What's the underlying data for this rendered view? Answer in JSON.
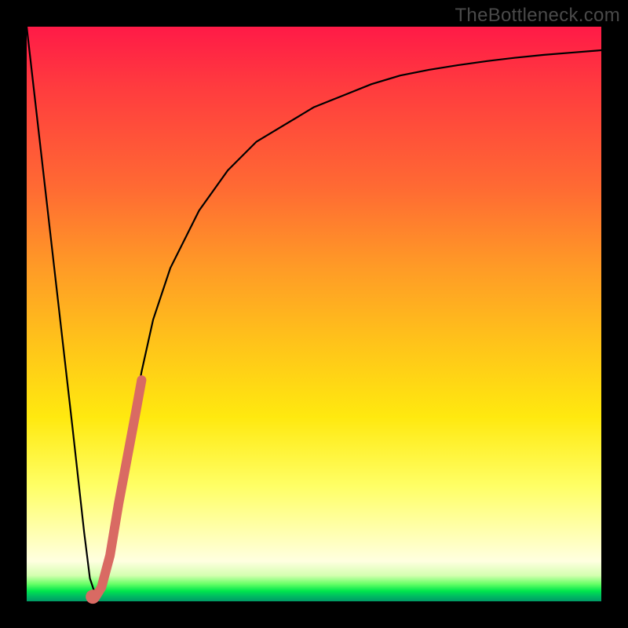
{
  "watermark": "TheBottleneck.com",
  "chart_data": {
    "type": "line",
    "title": "",
    "xlabel": "",
    "ylabel": "",
    "xlim": [
      0,
      100
    ],
    "ylim": [
      0,
      100
    ],
    "grid": false,
    "legend": false,
    "series": [
      {
        "name": "bottleneck-curve",
        "color": "#000000",
        "x": [
          0,
          4,
          8,
          10,
          11,
          12,
          13,
          14,
          16,
          18,
          20,
          22,
          25,
          30,
          35,
          40,
          45,
          50,
          55,
          60,
          65,
          70,
          75,
          80,
          85,
          90,
          95,
          100
        ],
        "values": [
          100,
          65,
          30,
          12,
          4,
          1,
          2,
          6,
          17,
          29,
          40,
          49,
          58,
          68,
          75,
          80,
          83,
          86,
          88,
          90,
          91.5,
          92.5,
          93.3,
          94,
          94.6,
          95.1,
          95.5,
          95.9
        ]
      },
      {
        "name": "highlight-segment",
        "color": "#d96a63",
        "x": [
          12.0,
          13.0,
          14.5,
          16.0,
          17.5,
          19.0,
          20.0
        ],
        "values": [
          0.8,
          2.4,
          8.0,
          17.0,
          25.0,
          33.0,
          38.5
        ]
      }
    ],
    "marker": {
      "x": 11.5,
      "y": 0.8,
      "color": "#d96a63"
    }
  },
  "gradient_colors": {
    "top": "#ff1a47",
    "mid": "#ffe90f",
    "bottom": "#00c060"
  }
}
